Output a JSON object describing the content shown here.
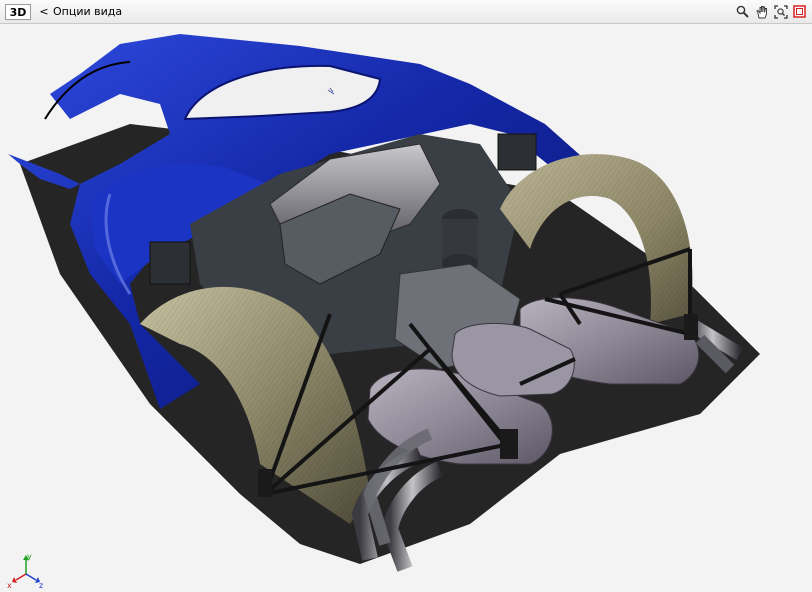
{
  "header": {
    "mode_badge": "3D",
    "back_label": "<",
    "title": "Опции вида"
  },
  "toolbar": {
    "buttons": [
      {
        "icon": "magnifier-icon"
      },
      {
        "icon": "pan-hand-icon"
      },
      {
        "icon": "zoom-fit-icon"
      },
      {
        "icon": "close-icon"
      }
    ]
  },
  "viewport": {
    "content": "3d-car-rear-engine-model",
    "axis_labels": {
      "x": "x",
      "y": "y",
      "z": "z"
    }
  },
  "colors": {
    "body_blue": "#1428a8",
    "carbon": "#8f8a6a",
    "axis_x": "#d02020",
    "axis_y": "#20a020",
    "axis_z": "#2040d0",
    "close_red": "#d62020"
  }
}
